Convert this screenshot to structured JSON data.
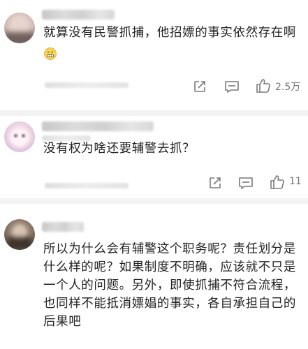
{
  "comments": [
    {
      "text_lines": [
        "就算没有民警抓捕，他招嫖的事实依然存在啊"
      ],
      "like_count": "2.5万",
      "icons": [
        "share-icon",
        "comment-icon",
        "like-icon"
      ],
      "emoji": "grimace-emoji"
    },
    {
      "text_lines": [
        "没有权为啥还要辅警去抓？"
      ],
      "like_count": "11",
      "icons": [
        "share-icon",
        "comment-icon",
        "like-icon"
      ]
    },
    {
      "text_lines": [
        "所以为什么会有辅警这个职务呢？责任划分是",
        "什么样的呢？如果制度不明确，应该就不只是",
        "一个人的问题。另外，即使抓捕不符合流程，",
        "也同样不能抵消嫖娼的事实，各自承担自己的",
        "后果吧"
      ]
    }
  ],
  "colors": {
    "background": "#f3f3f3",
    "card": "#ffffff",
    "text": "#222222",
    "icon": "#7a7a7a"
  }
}
